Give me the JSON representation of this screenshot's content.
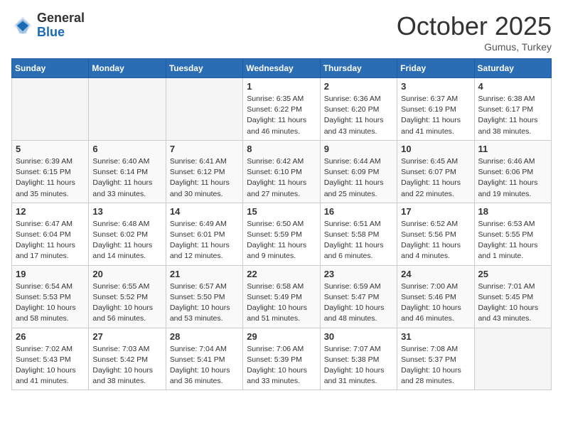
{
  "logo": {
    "general": "General",
    "blue": "Blue"
  },
  "header": {
    "month": "October 2025",
    "location": "Gumus, Turkey"
  },
  "weekdays": [
    "Sunday",
    "Monday",
    "Tuesday",
    "Wednesday",
    "Thursday",
    "Friday",
    "Saturday"
  ],
  "weeks": [
    [
      {
        "day": "",
        "info": ""
      },
      {
        "day": "",
        "info": ""
      },
      {
        "day": "",
        "info": ""
      },
      {
        "day": "1",
        "info": "Sunrise: 6:35 AM\nSunset: 6:22 PM\nDaylight: 11 hours\nand 46 minutes."
      },
      {
        "day": "2",
        "info": "Sunrise: 6:36 AM\nSunset: 6:20 PM\nDaylight: 11 hours\nand 43 minutes."
      },
      {
        "day": "3",
        "info": "Sunrise: 6:37 AM\nSunset: 6:19 PM\nDaylight: 11 hours\nand 41 minutes."
      },
      {
        "day": "4",
        "info": "Sunrise: 6:38 AM\nSunset: 6:17 PM\nDaylight: 11 hours\nand 38 minutes."
      }
    ],
    [
      {
        "day": "5",
        "info": "Sunrise: 6:39 AM\nSunset: 6:15 PM\nDaylight: 11 hours\nand 35 minutes."
      },
      {
        "day": "6",
        "info": "Sunrise: 6:40 AM\nSunset: 6:14 PM\nDaylight: 11 hours\nand 33 minutes."
      },
      {
        "day": "7",
        "info": "Sunrise: 6:41 AM\nSunset: 6:12 PM\nDaylight: 11 hours\nand 30 minutes."
      },
      {
        "day": "8",
        "info": "Sunrise: 6:42 AM\nSunset: 6:10 PM\nDaylight: 11 hours\nand 27 minutes."
      },
      {
        "day": "9",
        "info": "Sunrise: 6:44 AM\nSunset: 6:09 PM\nDaylight: 11 hours\nand 25 minutes."
      },
      {
        "day": "10",
        "info": "Sunrise: 6:45 AM\nSunset: 6:07 PM\nDaylight: 11 hours\nand 22 minutes."
      },
      {
        "day": "11",
        "info": "Sunrise: 6:46 AM\nSunset: 6:06 PM\nDaylight: 11 hours\nand 19 minutes."
      }
    ],
    [
      {
        "day": "12",
        "info": "Sunrise: 6:47 AM\nSunset: 6:04 PM\nDaylight: 11 hours\nand 17 minutes."
      },
      {
        "day": "13",
        "info": "Sunrise: 6:48 AM\nSunset: 6:02 PM\nDaylight: 11 hours\nand 14 minutes."
      },
      {
        "day": "14",
        "info": "Sunrise: 6:49 AM\nSunset: 6:01 PM\nDaylight: 11 hours\nand 12 minutes."
      },
      {
        "day": "15",
        "info": "Sunrise: 6:50 AM\nSunset: 5:59 PM\nDaylight: 11 hours\nand 9 minutes."
      },
      {
        "day": "16",
        "info": "Sunrise: 6:51 AM\nSunset: 5:58 PM\nDaylight: 11 hours\nand 6 minutes."
      },
      {
        "day": "17",
        "info": "Sunrise: 6:52 AM\nSunset: 5:56 PM\nDaylight: 11 hours\nand 4 minutes."
      },
      {
        "day": "18",
        "info": "Sunrise: 6:53 AM\nSunset: 5:55 PM\nDaylight: 11 hours\nand 1 minute."
      }
    ],
    [
      {
        "day": "19",
        "info": "Sunrise: 6:54 AM\nSunset: 5:53 PM\nDaylight: 10 hours\nand 58 minutes."
      },
      {
        "day": "20",
        "info": "Sunrise: 6:55 AM\nSunset: 5:52 PM\nDaylight: 10 hours\nand 56 minutes."
      },
      {
        "day": "21",
        "info": "Sunrise: 6:57 AM\nSunset: 5:50 PM\nDaylight: 10 hours\nand 53 minutes."
      },
      {
        "day": "22",
        "info": "Sunrise: 6:58 AM\nSunset: 5:49 PM\nDaylight: 10 hours\nand 51 minutes."
      },
      {
        "day": "23",
        "info": "Sunrise: 6:59 AM\nSunset: 5:47 PM\nDaylight: 10 hours\nand 48 minutes."
      },
      {
        "day": "24",
        "info": "Sunrise: 7:00 AM\nSunset: 5:46 PM\nDaylight: 10 hours\nand 46 minutes."
      },
      {
        "day": "25",
        "info": "Sunrise: 7:01 AM\nSunset: 5:45 PM\nDaylight: 10 hours\nand 43 minutes."
      }
    ],
    [
      {
        "day": "26",
        "info": "Sunrise: 7:02 AM\nSunset: 5:43 PM\nDaylight: 10 hours\nand 41 minutes."
      },
      {
        "day": "27",
        "info": "Sunrise: 7:03 AM\nSunset: 5:42 PM\nDaylight: 10 hours\nand 38 minutes."
      },
      {
        "day": "28",
        "info": "Sunrise: 7:04 AM\nSunset: 5:41 PM\nDaylight: 10 hours\nand 36 minutes."
      },
      {
        "day": "29",
        "info": "Sunrise: 7:06 AM\nSunset: 5:39 PM\nDaylight: 10 hours\nand 33 minutes."
      },
      {
        "day": "30",
        "info": "Sunrise: 7:07 AM\nSunset: 5:38 PM\nDaylight: 10 hours\nand 31 minutes."
      },
      {
        "day": "31",
        "info": "Sunrise: 7:08 AM\nSunset: 5:37 PM\nDaylight: 10 hours\nand 28 minutes."
      },
      {
        "day": "",
        "info": ""
      }
    ]
  ]
}
